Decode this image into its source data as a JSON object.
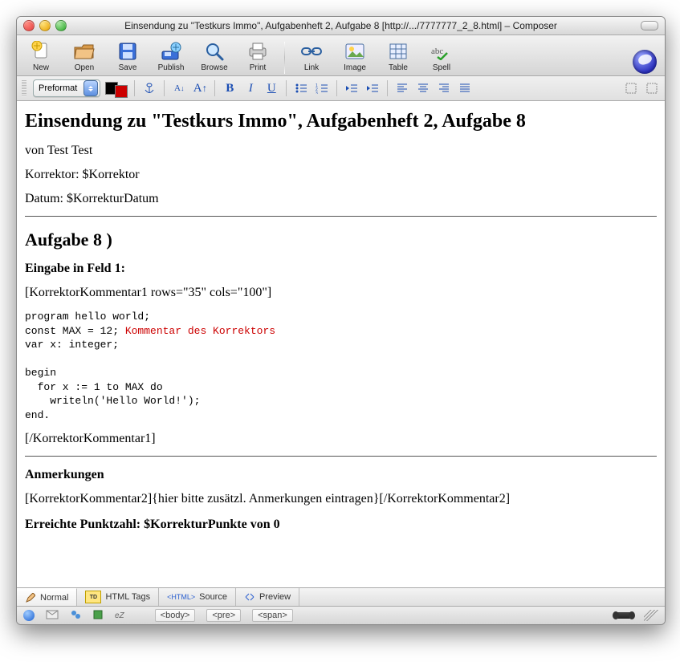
{
  "window": {
    "title": "Einsendung zu \"Testkurs Immo\", Aufgabenheft 2, Aufgabe 8 [http://.../7777777_2_8.html] – Composer"
  },
  "toolbar": {
    "new": "New",
    "open": "Open",
    "save": "Save",
    "publish": "Publish",
    "browse": "Browse",
    "print": "Print",
    "link": "Link",
    "image": "Image",
    "table": "Table",
    "spell": "Spell"
  },
  "format": {
    "paragraph": "Preformat"
  },
  "doc": {
    "h1": "Einsendung zu \"Testkurs Immo\", Aufgabenheft 2, Aufgabe 8",
    "author": "von Test Test",
    "korrektor": "Korrektor: $Korrektor",
    "datum": "Datum: $KorrekturDatum",
    "aufgabe": "Aufgabe 8 )",
    "eingabe": "Eingabe in Feld 1:",
    "komm_open": "[KorrektorKommentar1 rows=\"35\" cols=\"100\"]",
    "code_l1": "program hello world;",
    "code_l2a": "const MAX = 12; ",
    "code_l2b": "Kommentar des Korrektors",
    "code_l3": "var x: integer;",
    "code_l4": "",
    "code_l5": "begin",
    "code_l6": "  for x := 1 to MAX do",
    "code_l7": "    writeln('Hello World!');",
    "code_l8": "end.",
    "komm_close": "[/KorrektorKommentar1]",
    "anm_h": "Anmerkungen",
    "anm_line": "[KorrektorKommentar2]{hier bitte zusätzl. Anmerkungen eintragen}[/KorrektorKommentar2]",
    "punkte": "Erreichte Punktzahl: $KorrekturPunkte von 0"
  },
  "tabs": {
    "normal": "Normal",
    "htmltags": "HTML Tags",
    "source": "Source",
    "preview": "Preview",
    "htmlbadge": "<HTML>",
    "tdbadge": "TD"
  },
  "status": {
    "body": "<body>",
    "pre": "<pre>",
    "span": "<span>"
  }
}
